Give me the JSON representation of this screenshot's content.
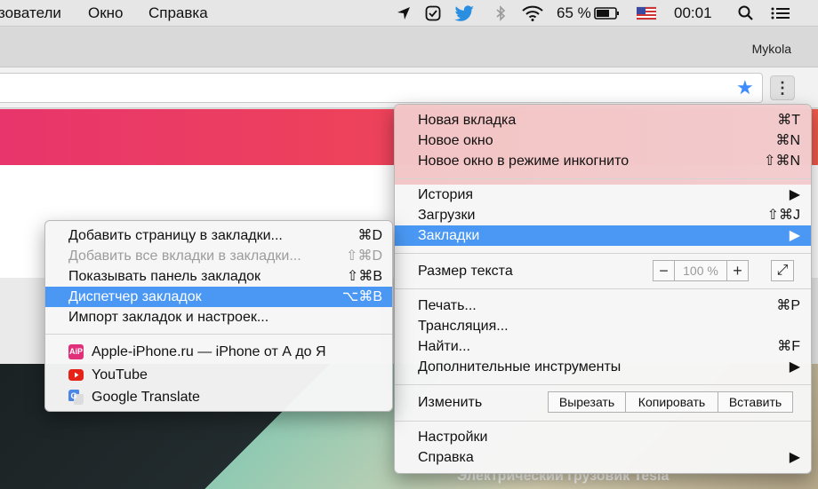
{
  "menubar": {
    "items": [
      "зователи",
      "Окно",
      "Справка"
    ],
    "battery": "65 %",
    "clock": "00:01"
  },
  "browser": {
    "profile_name": "Mykola"
  },
  "page": {
    "caption": "Электрический грузовик Tesla"
  },
  "main_menu": {
    "items": [
      {
        "label": "Новая вкладка",
        "shortcut": "⌘T"
      },
      {
        "label": "Новое окно",
        "shortcut": "⌘N"
      },
      {
        "label": "Новое окно в режиме инкогнито",
        "shortcut": "⇧⌘N"
      },
      {
        "label": "История",
        "shortcut": "▶"
      },
      {
        "label": "Загрузки",
        "shortcut": "⇧⌘J"
      },
      {
        "label": "Закладки",
        "shortcut": "▶"
      },
      {
        "label": "Размер текста",
        "shortcut": ""
      },
      {
        "label": "Печать...",
        "shortcut": "⌘P"
      },
      {
        "label": "Трансляция...",
        "shortcut": ""
      },
      {
        "label": "Найти...",
        "shortcut": "⌘F"
      },
      {
        "label": "Дополнительные инструменты",
        "shortcut": "▶"
      },
      {
        "label": "Изменить",
        "shortcut": ""
      },
      {
        "label": "Настройки",
        "shortcut": ""
      },
      {
        "label": "Справка",
        "shortcut": "▶"
      }
    ],
    "zoom": {
      "minus": "−",
      "value": "100 %",
      "plus": "+",
      "fullscreen": "⤢"
    },
    "edit": {
      "cut": "Вырезать",
      "copy": "Копировать",
      "paste": "Вставить"
    }
  },
  "bookmarks_menu": {
    "items": [
      {
        "label": "Добавить страницу в закладки...",
        "shortcut": "⌘D"
      },
      {
        "label": "Добавить все вкладки в закладки...",
        "shortcut": "⇧⌘D"
      },
      {
        "label": "Показывать панель закладок",
        "shortcut": "⇧⌘B"
      },
      {
        "label": "Диспетчер закладок",
        "shortcut": "⌥⌘B"
      },
      {
        "label": "Импорт закладок и настроек...",
        "shortcut": ""
      }
    ],
    "bookmarks": [
      {
        "label": "Apple-iPhone.ru — iPhone от А до Я",
        "icon": "aip-icon"
      },
      {
        "label": "YouTube",
        "icon": "youtube-icon"
      },
      {
        "label": "Google Translate",
        "icon": "google-translate-icon"
      }
    ]
  }
}
